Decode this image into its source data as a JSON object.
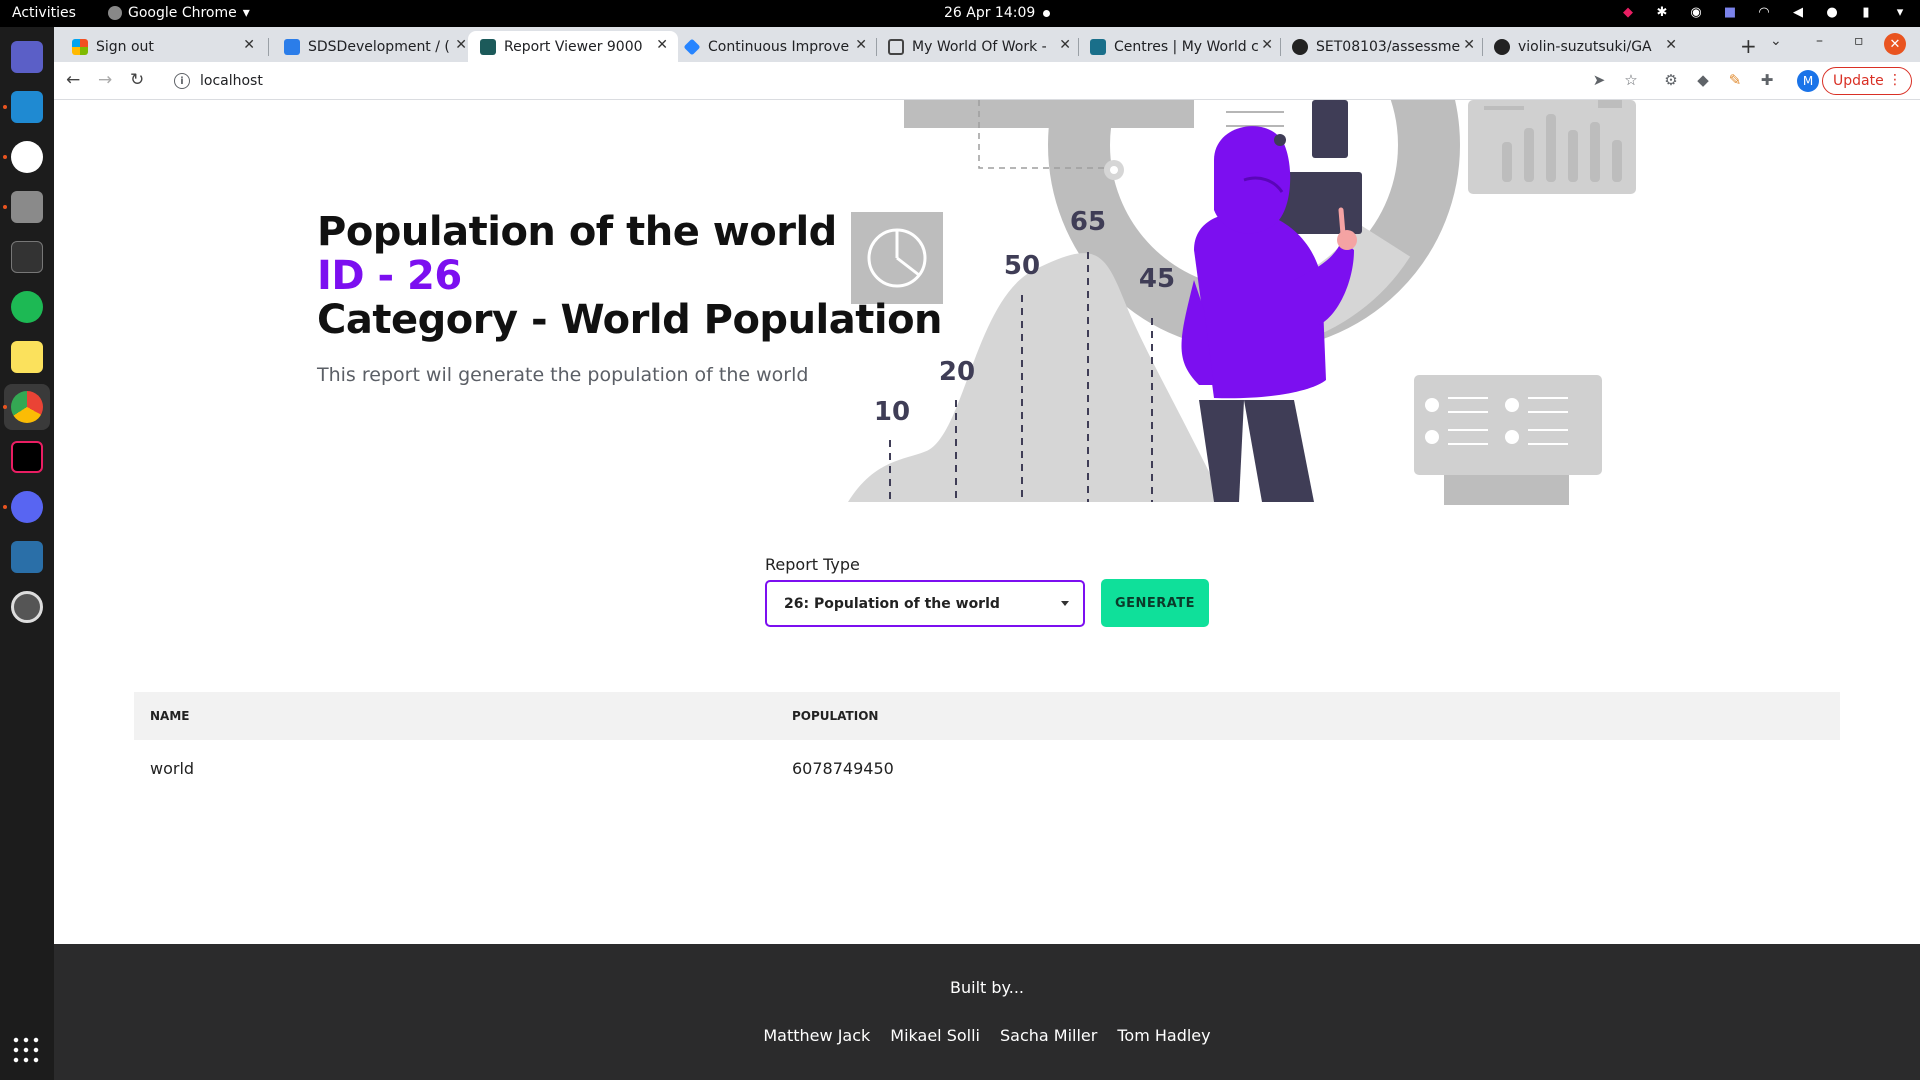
{
  "system": {
    "activities": "Activities",
    "app_name": "Google Chrome",
    "datetime": "26 Apr  14:09"
  },
  "tabs": [
    {
      "title": "Sign out",
      "color": "#f25022"
    },
    {
      "title": "SDSDevelopment / (",
      "color": "#2b7de9"
    },
    {
      "title": "Report Viewer 9000",
      "color": "#1c5a5a",
      "active": true
    },
    {
      "title": "Continuous Improve",
      "color": "#2684ff"
    },
    {
      "title": "My World Of Work -",
      "color": "#444444"
    },
    {
      "title": "Centres | My World c",
      "color": "#1a6f8a"
    },
    {
      "title": "SET08103/assessme",
      "color": "#222222"
    },
    {
      "title": "violin-suzutsuki/GA",
      "color": "#222222"
    }
  ],
  "address": {
    "url": "localhost"
  },
  "profile": {
    "initial": "M"
  },
  "update_label": "Update",
  "report": {
    "title": "Population of the world",
    "id_text": "ID - 26",
    "category_text": "Category - World Population",
    "description": "This report wil generate the population of the world"
  },
  "illustration": {
    "values": [
      "10",
      "20",
      "50",
      "65",
      "45"
    ]
  },
  "form": {
    "label": "Report Type",
    "selected": "26: Population of the world",
    "button": "GENERATE"
  },
  "table": {
    "columns": [
      "NAME",
      "POPULATION"
    ],
    "rows": [
      [
        "world",
        "6078749450"
      ]
    ]
  },
  "footer": {
    "built_by": "Built by...",
    "authors": [
      "Matthew Jack",
      "Mikael Solli",
      "Sacha Miller",
      "Tom Hadley"
    ]
  },
  "colors": {
    "accent": "#7c0ff0",
    "button": "#0fe09a",
    "footer": "#2b2b2c"
  }
}
